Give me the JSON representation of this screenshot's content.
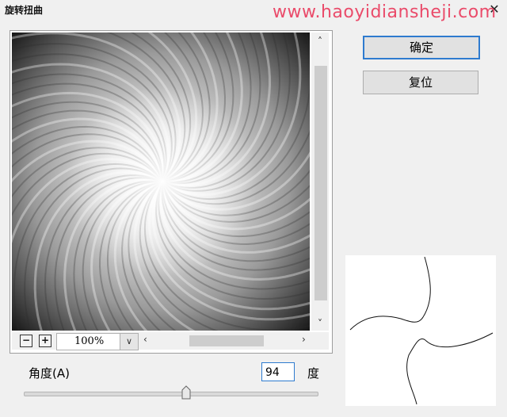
{
  "window": {
    "title": "旋转扭曲",
    "close_glyph": "✕"
  },
  "watermark": "www.haoyidiansheji.com",
  "preview": {
    "scroll_up": "˄",
    "scroll_down": "˅",
    "scroll_left": "‹",
    "scroll_right": "›",
    "zoom_out": "−",
    "zoom_in": "+",
    "zoom_value": "100%",
    "zoom_dropdown": "∨"
  },
  "buttons": {
    "ok": "确定",
    "reset": "复位"
  },
  "angle": {
    "label": "角度(A)",
    "value": "94",
    "unit": "度",
    "slider_fraction": 0.555
  },
  "colors": {
    "accent": "#2e7bcf",
    "watermark": "#ea4b6a"
  }
}
